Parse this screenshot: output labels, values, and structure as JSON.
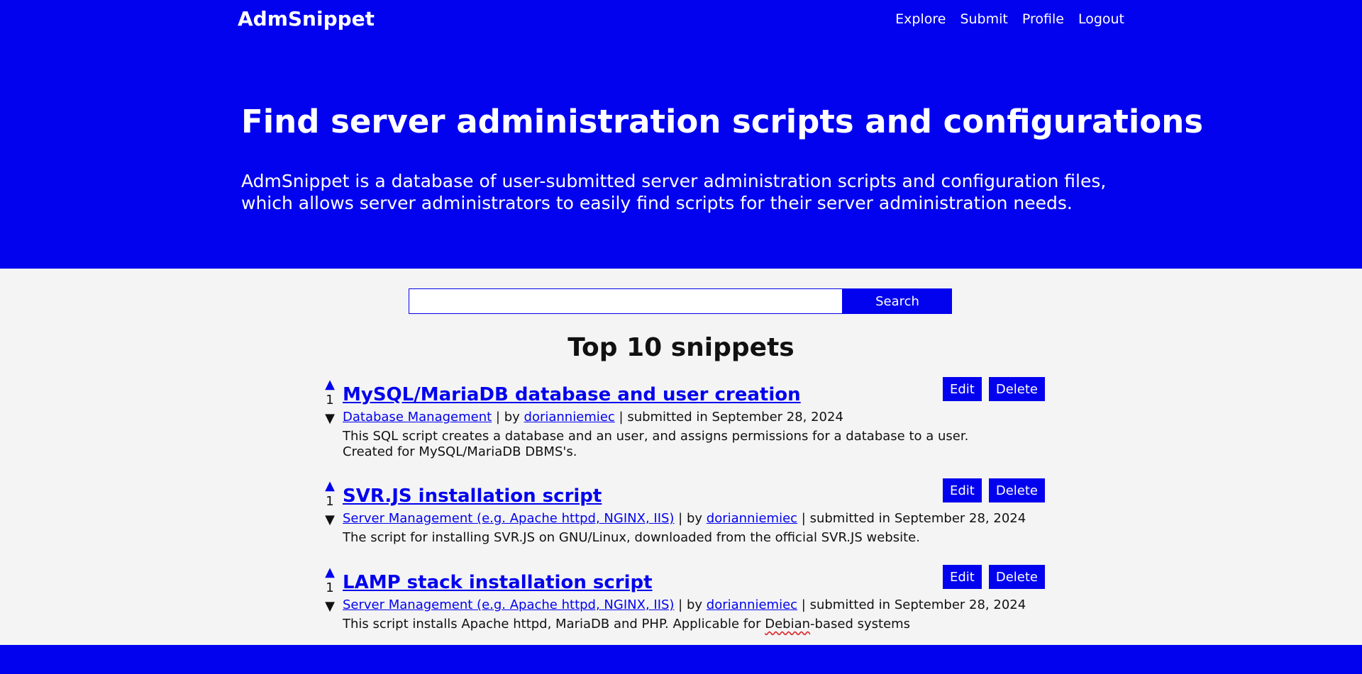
{
  "header": {
    "brand": "AdmSnippet",
    "nav": [
      "Explore",
      "Submit",
      "Profile",
      "Logout"
    ]
  },
  "hero": {
    "title": "Find server administration scripts and configurations",
    "description": "AdmSnippet is a database of user-submitted server administration scripts and configuration files, which allows server administrators to easily find scripts for their server administration needs."
  },
  "search": {
    "value": "",
    "button_label": "Search"
  },
  "section_title": "Top 10 snippets",
  "labels": {
    "sep": " | ",
    "by": "by",
    "submitted": "submitted in",
    "edit": "Edit",
    "delete": "Delete",
    "up_icon": "▲",
    "down_icon": "▼"
  },
  "snippets": [
    {
      "votes": "1",
      "title": "MySQL/MariaDB database and user creation",
      "category": "Database Management",
      "author": "dorianniemiec",
      "date": "September 28, 2024",
      "description": "This SQL script creates a database and an user, and assigns permissions for a database to a user. Created for MySQL/MariaDB DBMS's."
    },
    {
      "votes": "1",
      "title": "SVR.JS installation script",
      "category": "Server Management (e.g. Apache httpd, NGINX, IIS)",
      "author": "dorianniemiec",
      "date": "September 28, 2024",
      "description": "The script for installing SVR.JS on GNU/Linux, downloaded from the official SVR.JS website."
    },
    {
      "votes": "1",
      "title": "LAMP stack installation script",
      "category": "Server Management (e.g. Apache httpd, NGINX, IIS)",
      "author": "dorianniemiec",
      "date": "September 28, 2024",
      "description_pre": "This script installs Apache httpd, MariaDB and PHP. Applicable for ",
      "description_flag": "Debian",
      "description_post": "-based systems"
    }
  ],
  "colors": {
    "brand_blue": "#0202ee",
    "page_bg": "#f4f4f4"
  }
}
